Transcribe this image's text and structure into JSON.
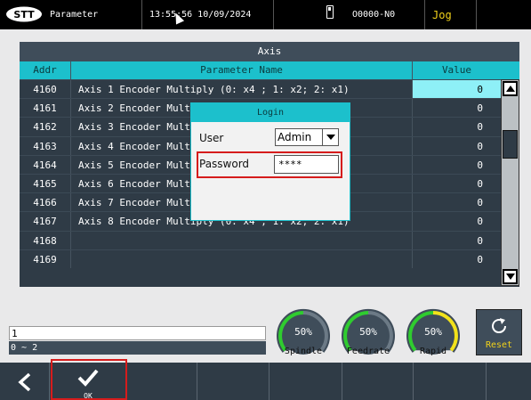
{
  "topbar": {
    "screen_name": "Parameter",
    "datetime": "13:55:56 10/09/2024",
    "program": "O0000-N0",
    "mode": "Jog"
  },
  "table": {
    "title": "Axis",
    "headers": {
      "addr": "Addr",
      "name": "Parameter Name",
      "value": "Value"
    },
    "rows": [
      {
        "addr": "4160",
        "name": "Axis 1 Encoder Multiply (0: x4 ; 1: x2; 2: x1)",
        "value": "0"
      },
      {
        "addr": "4161",
        "name": "Axis 2 Encoder Mult",
        "value": "0"
      },
      {
        "addr": "4162",
        "name": "Axis 3 Encoder Mult",
        "value": "0"
      },
      {
        "addr": "4163",
        "name": "Axis 4 Encoder Mult",
        "value": "0"
      },
      {
        "addr": "4164",
        "name": "Axis 5 Encoder Mult",
        "value": "0"
      },
      {
        "addr": "4165",
        "name": "Axis 6 Encoder Mult",
        "value": "0"
      },
      {
        "addr": "4166",
        "name": "Axis 7 Encoder Mult",
        "value": "0"
      },
      {
        "addr": "4167",
        "name": "Axis 8 Encoder Multiply (0: x4 ; 1: x2; 2: x1)",
        "value": "0"
      },
      {
        "addr": "4168",
        "name": "",
        "value": "0"
      },
      {
        "addr": "4169",
        "name": "",
        "value": "0"
      }
    ]
  },
  "login": {
    "title": "Login",
    "user_label": "User",
    "user_value": "Admin",
    "password_label": "Password",
    "password_value": "****"
  },
  "entry": {
    "value": "1",
    "range": "0 ~ 2"
  },
  "gauges": [
    {
      "label": "Spindle",
      "percent": "50%",
      "color": "#2fcc2f"
    },
    {
      "label": "Feedrate",
      "percent": "50%",
      "color": "#2fcc2f"
    },
    {
      "label": "Rapid",
      "percent": "50%",
      "color": "#f2e21a"
    }
  ],
  "reset_label": "Reset",
  "softkeys": {
    "ok_label": "OK"
  },
  "colors": {
    "accent": "#1cc0cc",
    "highlight": "#d61c1c",
    "mode": "#f2d21a"
  }
}
